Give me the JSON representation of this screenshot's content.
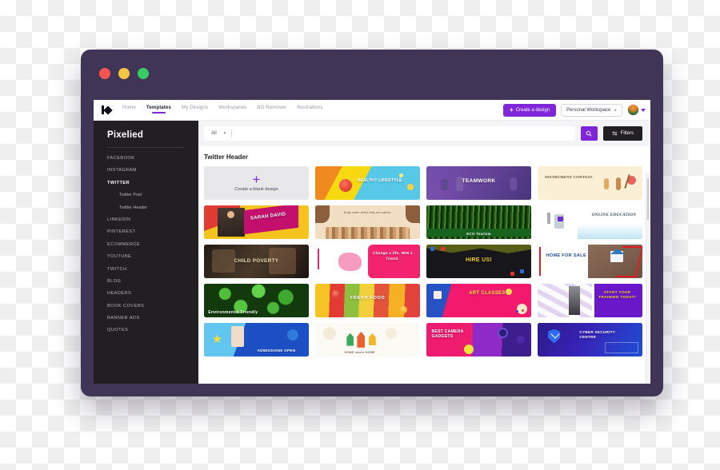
{
  "window": {
    "traffic_lights": [
      {
        "name": "close",
        "color": "#F4564F"
      },
      {
        "name": "minimize",
        "color": "#F6C544"
      },
      {
        "name": "maximize",
        "color": "#38CB63"
      }
    ],
    "chrome_color": "#403457"
  },
  "navbar": {
    "logo_label": "Pixelied",
    "links": [
      {
        "label": "Home",
        "active": false
      },
      {
        "label": "Templates",
        "active": true
      },
      {
        "label": "My Designs",
        "active": false
      },
      {
        "label": "Workspaces",
        "active": false
      },
      {
        "label": "BG Remover",
        "active": false
      },
      {
        "label": "Illustrations",
        "active": false
      }
    ],
    "create_button": "Create a design",
    "create_button_plus": "+",
    "workspace_selector": "Personal Workspace",
    "caret": "∨",
    "accent_color": "#8026d8"
  },
  "sidebar": {
    "brand": "Pixelied",
    "items": [
      {
        "label": "FACEBOOK",
        "active": false,
        "sub": false
      },
      {
        "label": "INSTAGRAM",
        "active": false,
        "sub": false
      },
      {
        "label": "TWITTER",
        "active": true,
        "sub": false
      },
      {
        "label": "Twitter Post",
        "active": false,
        "sub": true
      },
      {
        "label": "Twitter Header",
        "active": false,
        "sub": true
      },
      {
        "label": "LINKEDIN",
        "active": false,
        "sub": false
      },
      {
        "label": "PINTEREST",
        "active": false,
        "sub": false
      },
      {
        "label": "ECOMMERCE",
        "active": false,
        "sub": false
      },
      {
        "label": "YOUTUBE",
        "active": false,
        "sub": false
      },
      {
        "label": "TWITCH",
        "active": false,
        "sub": false
      },
      {
        "label": "BLOG",
        "active": false,
        "sub": false
      },
      {
        "label": "HEADERS",
        "active": false,
        "sub": false
      },
      {
        "label": "BOOK COVERS",
        "active": false,
        "sub": false
      },
      {
        "label": "BANNER ADS",
        "active": false,
        "sub": false
      },
      {
        "label": "QUOTES",
        "active": false,
        "sub": false
      }
    ]
  },
  "search": {
    "scope_label": "All",
    "scope_caret": "▾",
    "query": "",
    "placeholder": "",
    "search_icon": "search-icon",
    "filters_label": "Filters"
  },
  "results": {
    "section_title": "Twitter Header",
    "blank_card": {
      "plus": "+",
      "label": "Create a blank design"
    },
    "templates": [
      {
        "caption": "HEALTHY LIFESTYLE",
        "theme": "healthy-lifestyle"
      },
      {
        "caption": "TEAMWORK",
        "theme": "teamwork"
      },
      {
        "caption": "INSTRUMENT CONTEST",
        "theme": "instrument-contest"
      },
      {
        "caption": "SARAH DAVID",
        "theme": "sarah-david"
      },
      {
        "caption": "Dogs come when they are called.",
        "theme": "dogs-cats"
      },
      {
        "caption": "ECO Tourism",
        "theme": "eco-tourism"
      },
      {
        "caption": "ONLINE EDUCATION",
        "theme": "online-education"
      },
      {
        "caption": "CHILD POVERTY",
        "theme": "child-poverty"
      },
      {
        "caption": "Change a life. WIN a friend.",
        "theme": "change-a-life"
      },
      {
        "caption": "HIRE US!",
        "theme": "hire-us"
      },
      {
        "caption": "HOME FOR SALE",
        "theme": "home-for-sale"
      },
      {
        "caption": "Environmental Friendly",
        "theme": "environmental-friendly"
      },
      {
        "caption": "FRESH FOOD",
        "theme": "fresh-food"
      },
      {
        "caption": "ART CLASSES",
        "theme": "art-classes"
      },
      {
        "caption": "START YOUR TRAINING TODAY!",
        "theme": "training"
      },
      {
        "caption": "ADMISSIONS OPEN",
        "theme": "admissions-open"
      },
      {
        "caption": "HOME sweet HOME",
        "theme": "home-sweet-home"
      },
      {
        "caption": "BEST CAMERA GADGETS",
        "theme": "camera-gadgets"
      },
      {
        "caption": "CYBER SECURITY CENTRE",
        "theme": "cyber-security"
      }
    ]
  }
}
